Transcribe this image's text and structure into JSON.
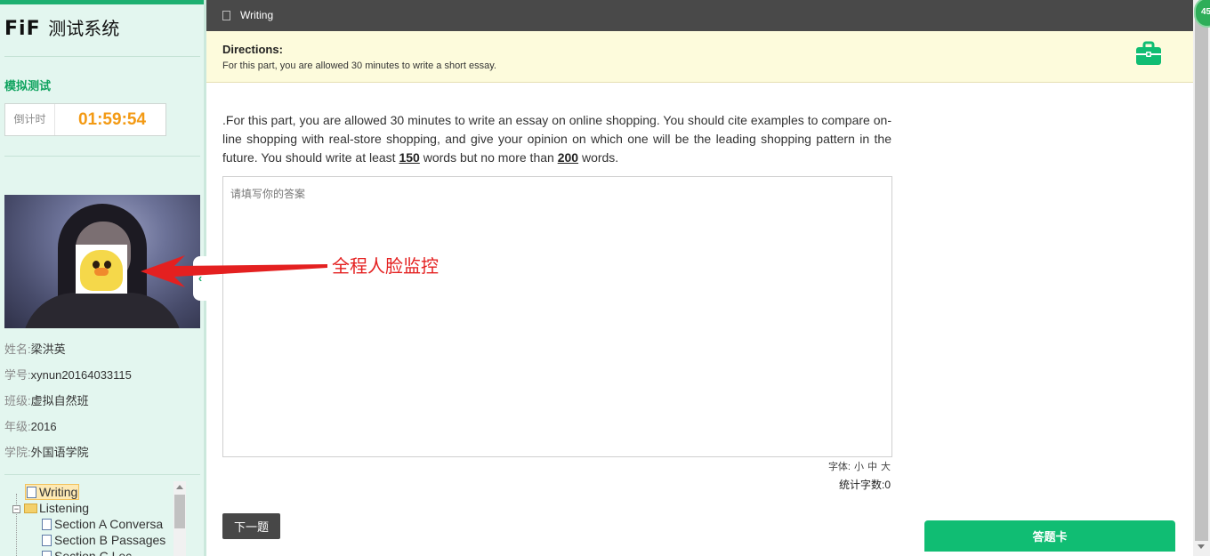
{
  "sidebar": {
    "logo_brand": "FiF",
    "logo_system": "测试系统",
    "mode": "模拟测试",
    "timer_label": "倒计时",
    "timer_value": "01:59:54",
    "student": [
      {
        "key": "姓名:",
        "value": "梁洪英"
      },
      {
        "key": "学号:",
        "value": "xynun20164033115"
      },
      {
        "key": "班级:",
        "value": "虚拟自然班"
      },
      {
        "key": "年级:",
        "value": "2016"
      },
      {
        "key": "学院:",
        "value": "外国语学院"
      }
    ],
    "tree": {
      "writing": "Writing",
      "listening": "Listening",
      "children": [
        "Section A Conversa",
        "Section B Passages",
        "Section C Lec"
      ]
    }
  },
  "header": {
    "title": "Writing"
  },
  "directions": {
    "heading": "Directions:",
    "text": "For this part, you are allowed 30 minutes to write a short essay."
  },
  "prompt": {
    "part1": ".For this part, you are allowed 30 minutes to write an essay on online shopping. You should cite examples to compare on-line shopping with real-store shopping, and give your opinion on which one will be the leading shopping pattern in the future. You should write at least ",
    "min_words": "150",
    "part2": " words but no more than ",
    "max_words": "200",
    "part3": " words."
  },
  "answer": {
    "placeholder": "请填写你的答案",
    "value": ""
  },
  "font_controls": {
    "label": "字体:",
    "small": "小",
    "medium": "中",
    "large": "大"
  },
  "word_count": {
    "label": "统计字数:",
    "value": "0"
  },
  "buttons": {
    "next": "下一题",
    "answer_card": "答题卡"
  },
  "annotation": "全程人脸监控",
  "badge": "45",
  "colors": {
    "accent": "#10bd73",
    "timer": "#f39a14",
    "header": "#494949",
    "annotation": "#e42020"
  }
}
